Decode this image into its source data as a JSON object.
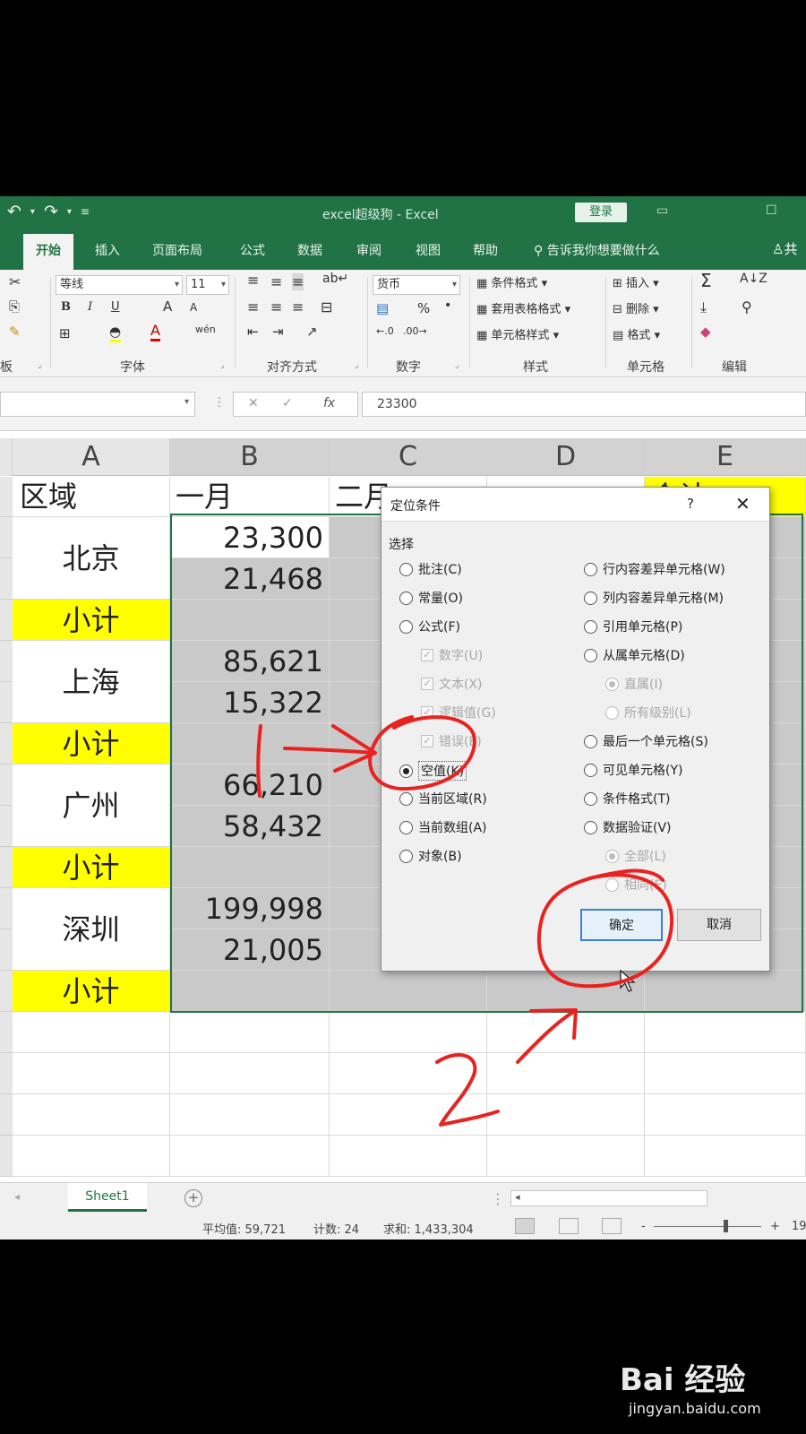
{
  "app": {
    "title": "excel超级狗 - Excel",
    "login_label": "登录",
    "share_label": "共",
    "qat_dropdown": "▾"
  },
  "ribbon_tabs": [
    "开始",
    "插入",
    "页面布局",
    "公式",
    "数据",
    "审阅",
    "视图",
    "帮助"
  ],
  "tell_me": "告诉我你想要做什么",
  "ribbon": {
    "clipboard_label": "板",
    "font": {
      "name": "等线",
      "size": "11",
      "bold": "B",
      "italic": "I",
      "underline": "U",
      "grow": "A",
      "shrink": "A",
      "wen": "wén",
      "label": "字体"
    },
    "alignment_label": "对齐方式",
    "number": {
      "format": "货币",
      "percent": "%",
      "comma": "•",
      "label": "数字"
    },
    "styles": {
      "conditional": "条件格式",
      "table": "套用表格格式",
      "cell": "单元格样式",
      "label": "样式"
    },
    "cells": {
      "insert": "插入",
      "delete": "删除",
      "format": "格式",
      "label": "单元格"
    },
    "editing_label": "编辑"
  },
  "formula_bar": {
    "fx": "fx",
    "value": "23300"
  },
  "columns": [
    "A",
    "B",
    "C",
    "D",
    "E"
  ],
  "header_row": {
    "a": "区域",
    "b": "一月",
    "c": "二月",
    "e": "合计"
  },
  "regions": [
    "北京",
    "上海",
    "广州",
    "深圳"
  ],
  "subtotal_label": "小计",
  "values": [
    "23,300",
    "21,468",
    "85,621",
    "15,322",
    "66,210",
    "58,432",
    "199,998",
    "21,005"
  ],
  "dialog": {
    "title": "定位条件",
    "help": "?",
    "close": "✕",
    "section": "选择",
    "left_options": [
      "批注(C)",
      "常量(O)",
      "公式(F)"
    ],
    "formula_sub": [
      "数字(U)",
      "文本(X)",
      "逻辑值(G)",
      "错误(E)"
    ],
    "selected_option": "空值(K)",
    "left_options_2": [
      "当前区域(R)",
      "当前数组(A)",
      "对象(B)"
    ],
    "right_options": [
      "行内容差异单元格(W)",
      "列内容差异单元格(M)",
      "引用单元格(P)",
      "从属单元格(D)"
    ],
    "dependents_sub": [
      "直属(I)",
      "所有级别(L)"
    ],
    "right_options_2": [
      "最后一个单元格(S)",
      "可见单元格(Y)",
      "条件格式(T)",
      "数据验证(V)"
    ],
    "validation_sub": [
      "全部(L)",
      "相同(E)"
    ],
    "ok": "确定",
    "cancel": "取消"
  },
  "sheet_tab": "Sheet1",
  "status": {
    "average": "平均值: 59,721",
    "count": "计数: 24",
    "sum": "求和: 1,433,304",
    "zoom_minus": "-",
    "zoom_plus": "+",
    "zoom": "19"
  },
  "annotations": {
    "one": "1",
    "two": "2"
  },
  "watermark": {
    "brand": "Bai 经验",
    "url": "jingyan.baidu.com"
  },
  "colors": {
    "excel_green": "#217346",
    "highlight_yellow": "#ffff00",
    "annotation_red": "#e8231f"
  }
}
